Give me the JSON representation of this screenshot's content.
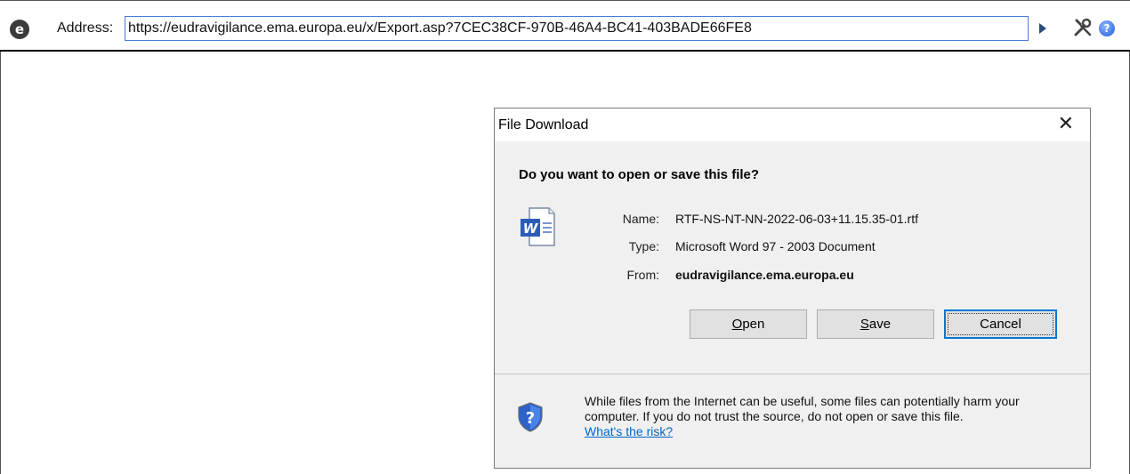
{
  "browser": {
    "address_label": "Address:",
    "url": "https://eudravigilance.ema.europa.eu/x/Export.asp?7CEC38CF-970B-46A4-BC41-403BADE66FE8",
    "logo_letter": "e",
    "icons": [
      "ie-logo-icon",
      "go-arrow-icon",
      "tools-icon",
      "help-icon"
    ]
  },
  "dialog": {
    "title": "File Download",
    "close_glyph": "✕",
    "question": "Do you want to open or save this file?",
    "file": {
      "name_label": "Name:",
      "name_value": "RTF-NS-NT-NN-2022-06-03+11.15.35-01.rtf",
      "type_label": "Type:",
      "type_value": "Microsoft Word 97 - 2003 Document",
      "from_label": "From:",
      "from_value": "eudravigilance.ema.europa.eu",
      "icon": "word-document-icon"
    },
    "buttons": {
      "open": "Open",
      "save": "Save",
      "cancel": "Cancel"
    },
    "warning": {
      "text": "While files from the Internet can be useful, some files can potentially harm your computer. If you do not trust the source, do not open or save this file.",
      "link": "What's the risk?",
      "icon": "security-shield-icon"
    }
  },
  "colors": {
    "link": "#0066cc",
    "default_button_border": "#0078d7",
    "dialog_background": "#f0f0f0"
  }
}
